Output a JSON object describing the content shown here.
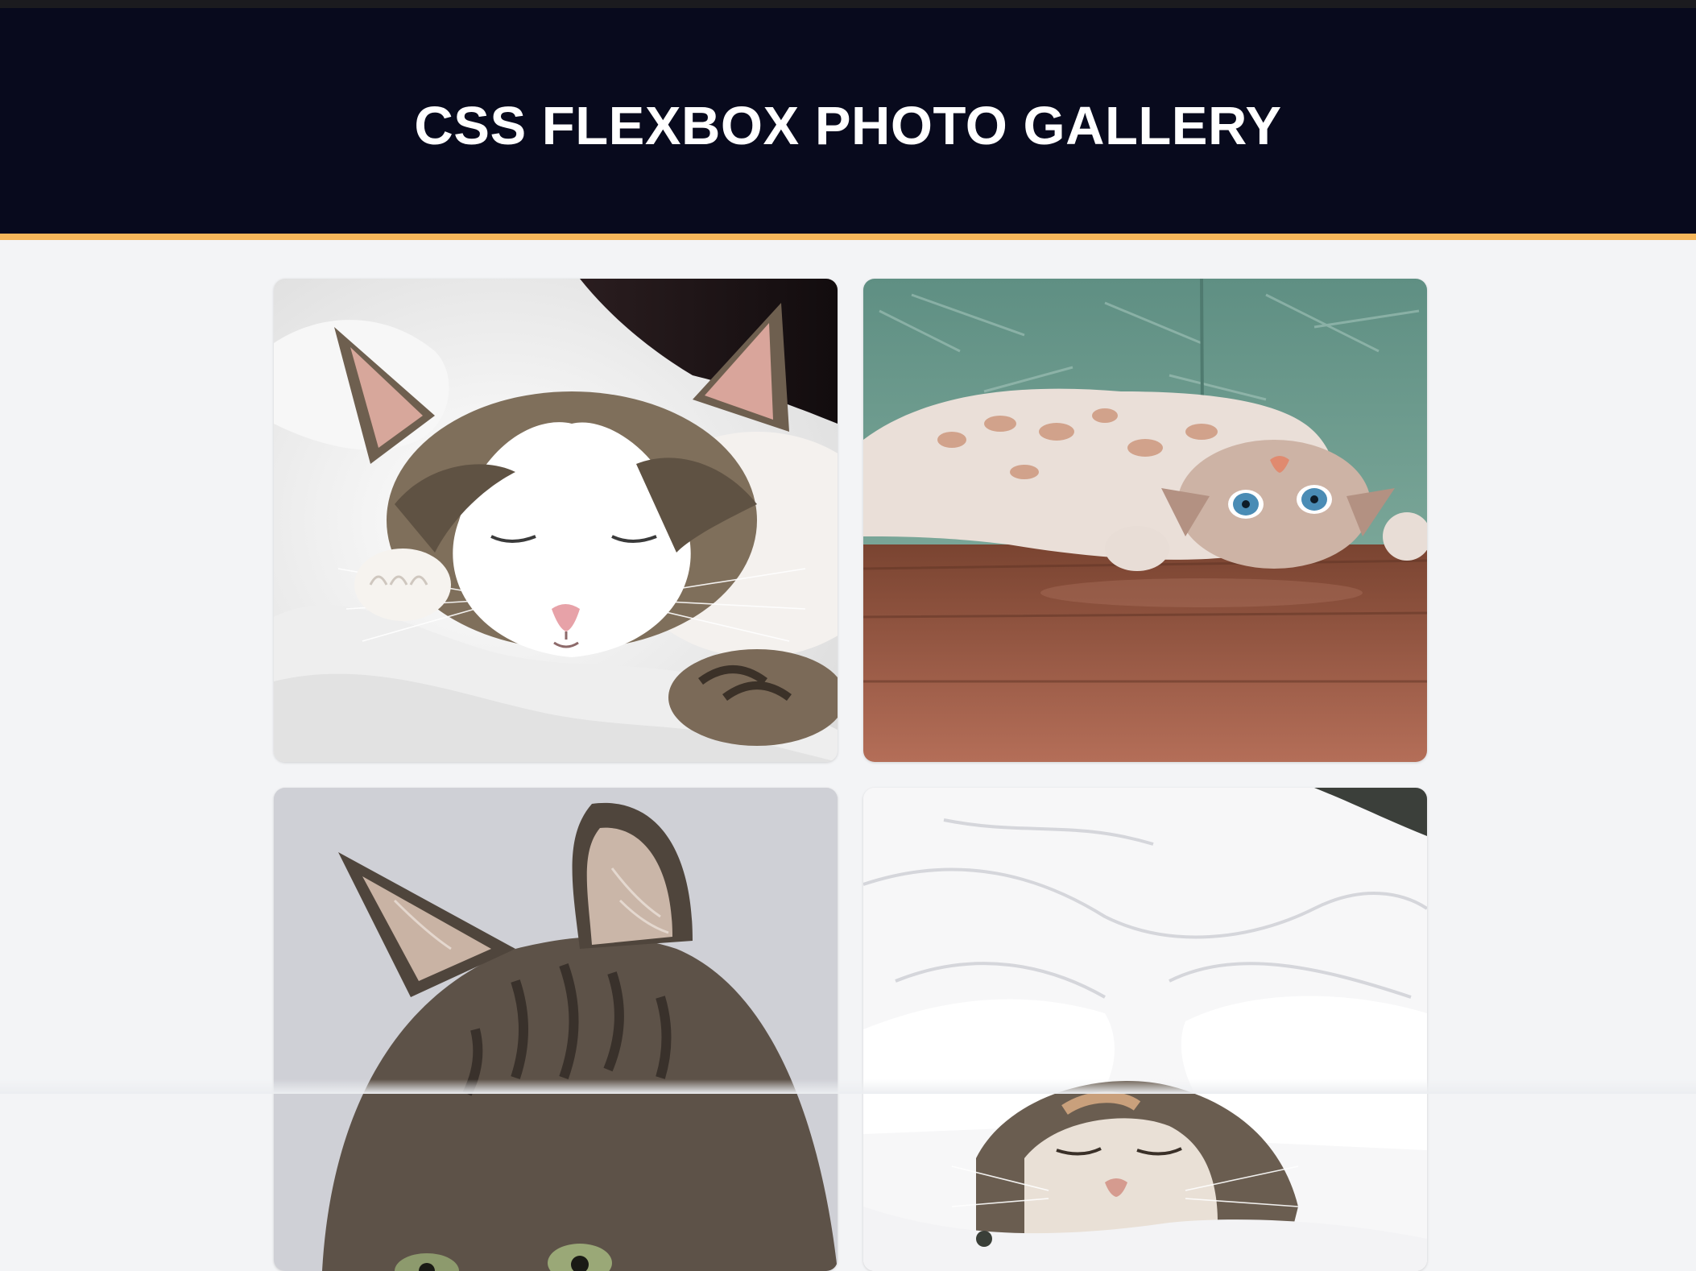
{
  "header": {
    "title": "CSS FLEXBOX PHOTO GALLERY",
    "accent_color": "#f6b65a",
    "background_color": "#080a1d"
  },
  "gallery": {
    "photos": [
      {
        "subject": "sleeping tabby and white cat on white bedding"
      },
      {
        "subject": "cat lying upside down on wooden floor"
      },
      {
        "subject": "close-up of long-haired tabby cat"
      },
      {
        "subject": "cat sleeping under white duvet"
      }
    ]
  }
}
